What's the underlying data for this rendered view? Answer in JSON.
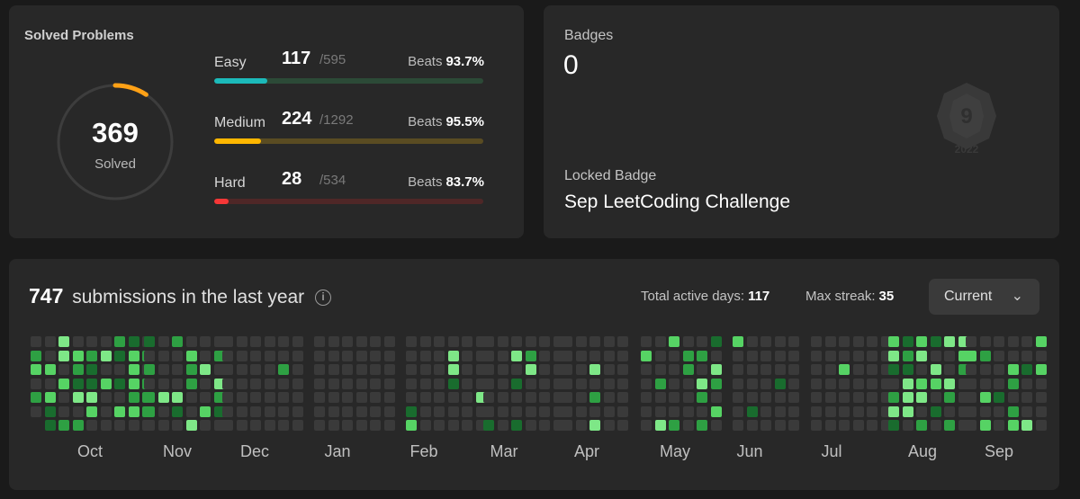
{
  "solved": {
    "title": "Solved Problems",
    "count": "369",
    "count_label": "Solved",
    "ring_fraction": 0.0919,
    "ring_color": "#ffa116",
    "difficulties": [
      {
        "name": "Easy",
        "solved": "117",
        "total": "/595",
        "beats_label": "Beats",
        "beats": "93.7%",
        "fraction": 0.197,
        "color": "#1cbaba",
        "track": "#2c4a37"
      },
      {
        "name": "Medium",
        "solved": "224",
        "total": "/1292",
        "beats_label": "Beats",
        "beats": "95.5%",
        "fraction": 0.173,
        "color": "#ffb700",
        "track": "#5a4c22"
      },
      {
        "name": "Hard",
        "solved": "28",
        "total": "/534",
        "beats_label": "Beats",
        "beats": "83.7%",
        "fraction": 0.052,
        "color": "#f63737",
        "track": "#4f2727"
      }
    ]
  },
  "badges": {
    "label": "Badges",
    "count": "0",
    "locked_label": "Locked Badge",
    "locked_name": "Sep LeetCoding Challenge",
    "ghost_icon": "badge-icon",
    "ghost_number": "9",
    "ghost_year": "2022"
  },
  "submissions": {
    "count": "747",
    "text": "submissions in the last year",
    "info_icon": "info-icon",
    "active_days_label": "Total active days:",
    "active_days": "117",
    "max_streak_label": "Max streak:",
    "max_streak": "35",
    "dropdown_selected": "Current",
    "months": [
      "Oct",
      "Nov",
      "Dec",
      "Jan",
      "Feb",
      "Mar",
      "Apr",
      "May",
      "Jun",
      "Jul",
      "Aug",
      "Sep"
    ],
    "colors": {
      "empty": "#3a3a3a",
      "l1": "#196c2e",
      "l2": "#2ea043",
      "l3": "#56d364",
      "l4": "#7ee787"
    }
  }
}
